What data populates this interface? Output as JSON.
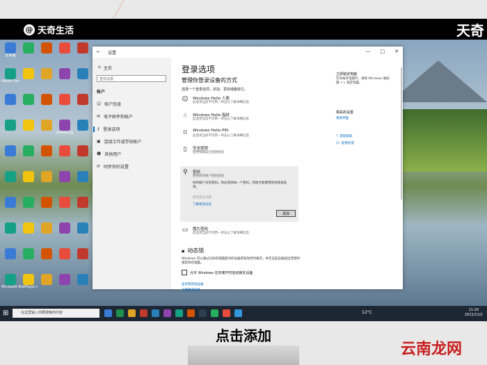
{
  "video_overlay": {
    "brand": "天奇生活",
    "brand_right": "天奇",
    "caption": "点击添加",
    "watermark": "云南龙网"
  },
  "window": {
    "back": "←",
    "title": "设置",
    "controls": [
      "—",
      "□",
      "✕"
    ]
  },
  "nav": {
    "home": "主页",
    "search_placeholder": "查找设置",
    "group": "帐户",
    "items": [
      "帐户信息",
      "电子邮件和帐户",
      "登录选项",
      "连接工作或学校帐户",
      "其他用户",
      "同步你的设置"
    ],
    "active_index": 2
  },
  "main": {
    "title": "登录选项",
    "subtitle": "管理你登录设备的方式",
    "intro": "选择一个登录选项，添加、更改或删除它。",
    "options": [
      {
        "icon": "☺",
        "name": "Windows Hello 人脸",
        "desc": "此选项当前不可用—单击以了解详细信息"
      },
      {
        "icon": "☝",
        "name": "Windows Hello 指纹",
        "desc": "此选项当前不可用—单击以了解详细信息"
      },
      {
        "icon": "⁞⁞",
        "name": "Windows Hello PIN",
        "desc": "此选项当前不可用—单击以了解详细信息"
      },
      {
        "icon": "▯",
        "name": "安全密钥",
        "desc": "使用物理安全密钥登录"
      }
    ],
    "password": {
      "icon": "⚲",
      "name": "密码",
      "desc": "使用你的帐户密码登录",
      "text": "你的帐户没有密码。你必须添加一个密码，然后才能使用其他登录选项。",
      "security_q": "更新安全问题",
      "learn_more": "了解更多信息",
      "button": "添加"
    },
    "picture_password": {
      "icon": "▭",
      "name": "图片密码",
      "desc": "此选项当前不可用—单击以了解详细信息"
    },
    "dynamic_lock": {
      "title": "动态锁",
      "text": "Windows 可以通过与你的电脑配对的设备获知你何时离开，并在这些设备超出范围时锁定你的电脑。",
      "checkbox": "允许 Windows 在你离开时自动锁定设备",
      "link1": "蓝牙和其他设备",
      "link2": "了解更多信息"
    }
  },
  "side": {
    "title1": "立即锁定电脑",
    "text1": "在你离开电脑时，请按 Windows 徽标键 + L 锁定电脑。",
    "title2": "相关的设置",
    "link_related": "锁屏界面",
    "help": "获取帮助",
    "feedback": "提供反馈"
  },
  "desktop_icons": [
    "此电脑",
    "",
    "",
    "",
    "",
    "Adobe Premiere",
    "",
    "",
    "",
    "",
    "",
    "",
    "",
    "",
    "",
    "",
    "",
    "",
    "debug.log",
    "",
    "",
    "",
    "",
    "",
    "",
    "",
    "",
    "",
    "",
    "",
    "",
    "",
    "",
    "",
    "",
    "",
    "",
    "",
    "",
    "",
    "",
    "",
    "",
    "",
    "",
    "Microsoft Edge",
    "PotPlayer 64 bit",
    "",
    "",
    ""
  ],
  "taskbar": {
    "search_placeholder": "在这里输入你要搜索的内容",
    "weather": "12°C",
    "time": "11:20",
    "date": "2021/11/2"
  },
  "colors": {
    "accent": "#0067c0",
    "watermark": "#c81e1e",
    "taskbar": "#1d2633"
  }
}
